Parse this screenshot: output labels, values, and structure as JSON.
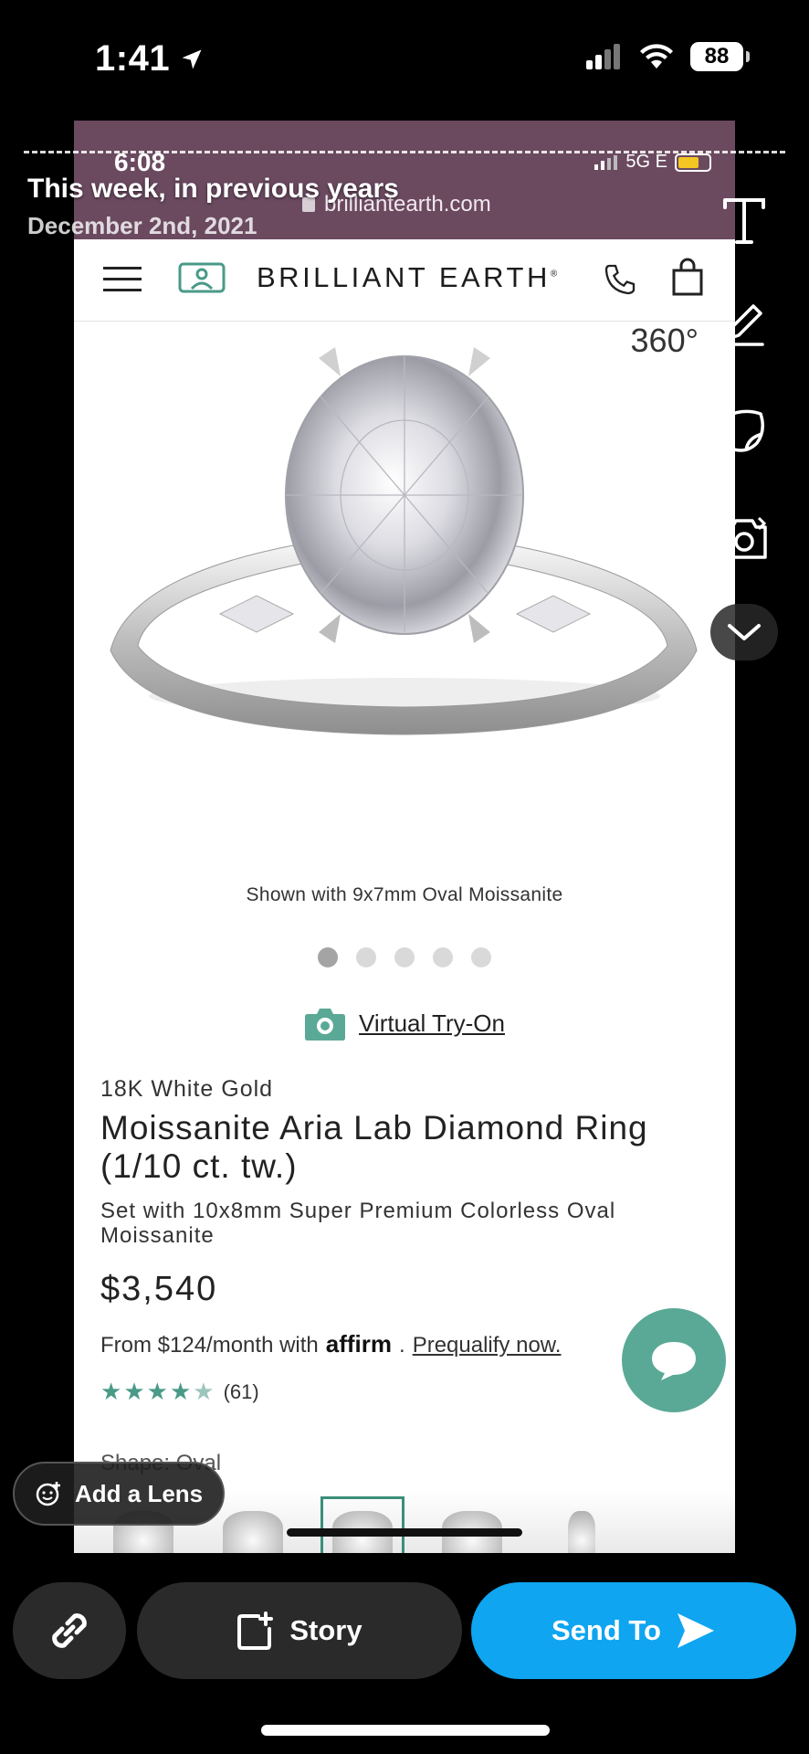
{
  "device_status": {
    "time": "1:41",
    "battery": "88"
  },
  "memory": {
    "title": "This week, in previous years",
    "date": "December 2nd, 2021"
  },
  "snapshot": {
    "status_time": "6:08",
    "network": "5G E",
    "url": "brilliantearth.com",
    "brand": "BRILLIANT EARTH",
    "view_360": "360°",
    "image_caption": "Shown with 9x7mm Oval Moissanite",
    "carousel": {
      "count": 5,
      "active": 0
    },
    "virtual_try_on": "Virtual Try-On",
    "product": {
      "metal": "18K White Gold",
      "name": "Moissanite Aria Lab Diamond Ring (1/10 ct. tw.)",
      "subtitle": "Set with 10x8mm Super Premium Colorless Oval Moissanite",
      "price": "$3,540",
      "finance_prefix": "From $124/month with",
      "finance_brand": "affirm",
      "prequalify": "Prequalify now.",
      "rating_stars": 4.5,
      "rating_count": "(61)",
      "shape_label": "Shape: Oval"
    },
    "colors": {
      "brand_teal": "#5aa996",
      "url_bar": "#6b4a60"
    }
  },
  "snap_ui": {
    "add_lens": "Add a Lens",
    "story": "Story",
    "send_to": "Send To",
    "colors": {
      "send_blue": "#0fa5f0",
      "button_dark": "#2a2a2a"
    }
  }
}
